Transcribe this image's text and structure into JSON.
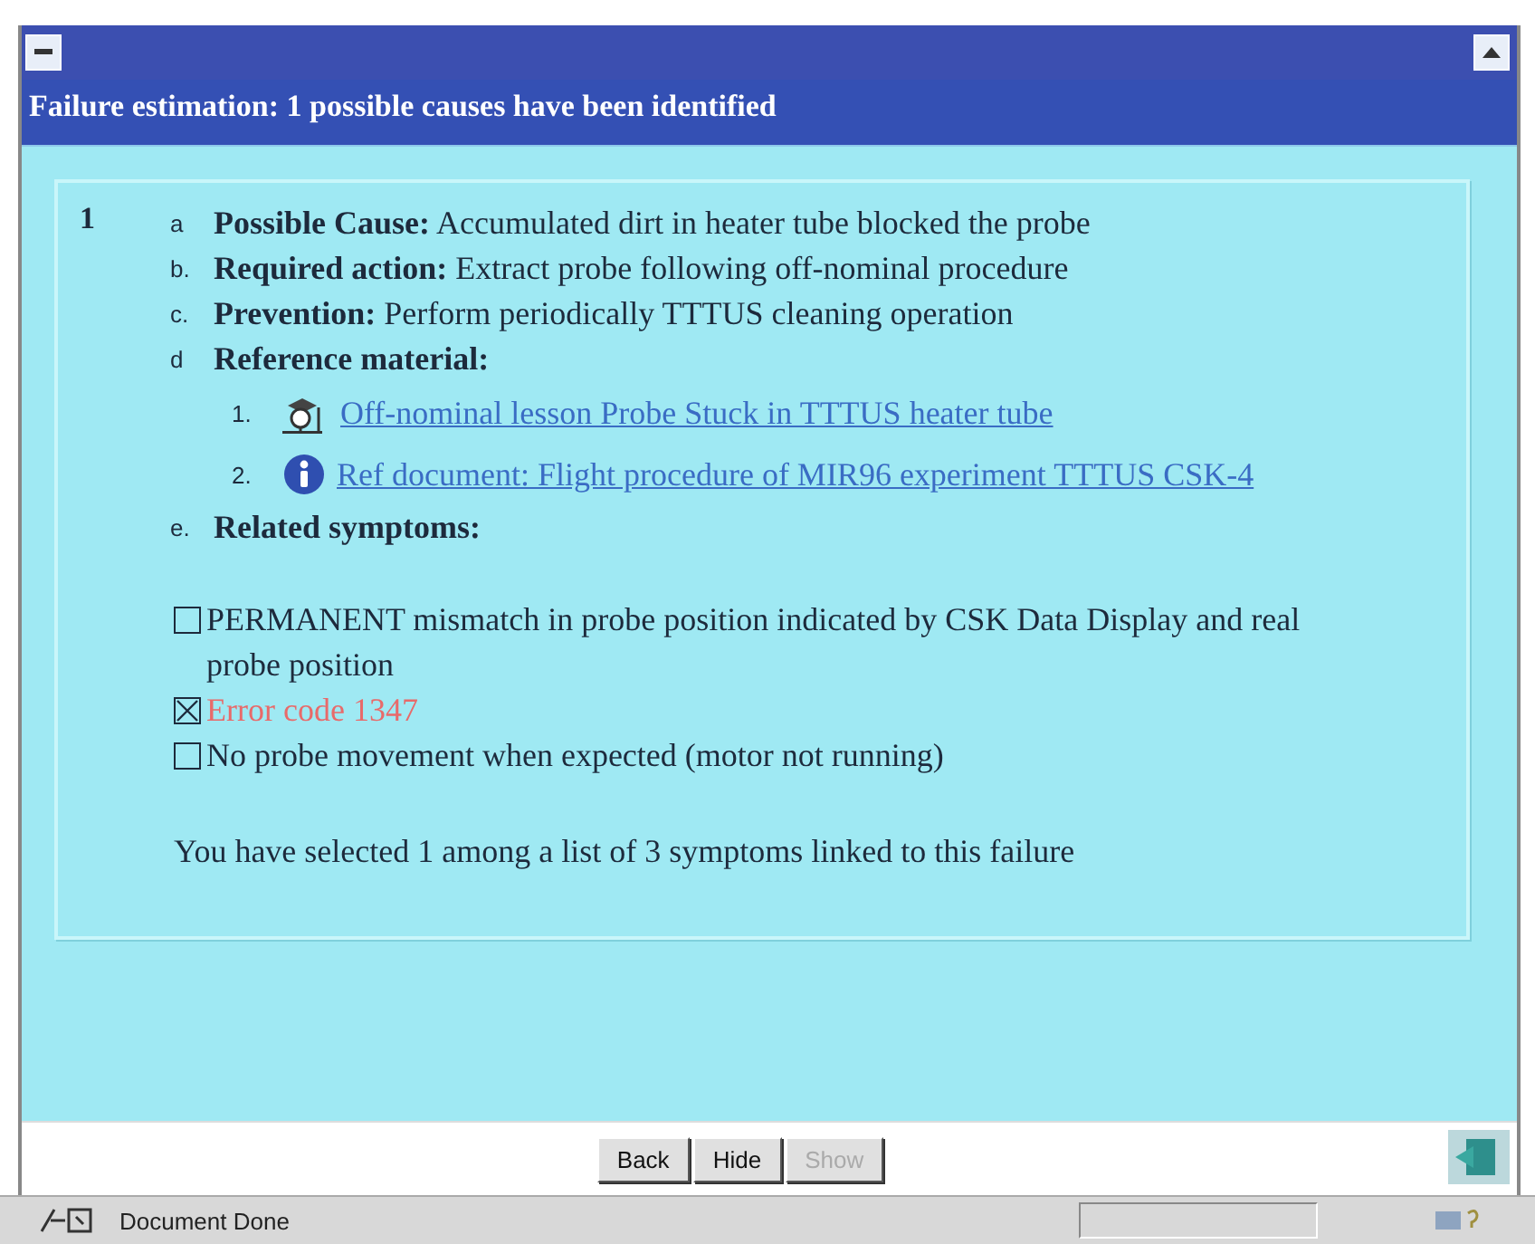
{
  "window": {
    "title": "Failure estimation: 1 possible causes have been identified"
  },
  "causes": [
    {
      "number": "1",
      "sections": [
        {
          "kind": "text",
          "marker": "a",
          "label": "Possible Cause:",
          "text": "Accumulated dirt in heater tube blocked the probe"
        },
        {
          "kind": "text",
          "marker": "b.",
          "label": "Required action:",
          "text": "Extract probe following off-nominal procedure"
        },
        {
          "kind": "text",
          "marker": "c.",
          "label": "Prevention:",
          "text": "Perform periodically TTTUS cleaning operation"
        },
        {
          "kind": "references",
          "marker": "d",
          "label": "Reference material:",
          "items": [
            {
              "number": "1.",
              "kind": "lesson",
              "text": "Off-nominal lesson Probe Stuck in TTTUS heater tube"
            },
            {
              "number": "2.",
              "kind": "document",
              "text": "Ref document: Flight procedure of MIR96 experiment TTTUS CSK-4"
            }
          ]
        },
        {
          "kind": "symptoms",
          "marker": "e.",
          "label": "Related symptoms:",
          "items": [
            {
              "text": "PERMANENT mismatch in probe position indicated by CSK Data Display and real probe position",
              "checked": false
            },
            {
              "text": "Error code 1347",
              "checked": true
            },
            {
              "text": "No probe movement when expected (motor not running)",
              "checked": false
            }
          ],
          "summary": "You have selected 1 among a list of 3 symptoms linked to this failure"
        }
      ]
    }
  ],
  "buttons": [
    {
      "label": "Back",
      "disabled": false
    },
    {
      "label": "Hide",
      "disabled": false
    },
    {
      "label": "Show",
      "disabled": true
    }
  ],
  "status_bar": {
    "text": "Document Done"
  }
}
